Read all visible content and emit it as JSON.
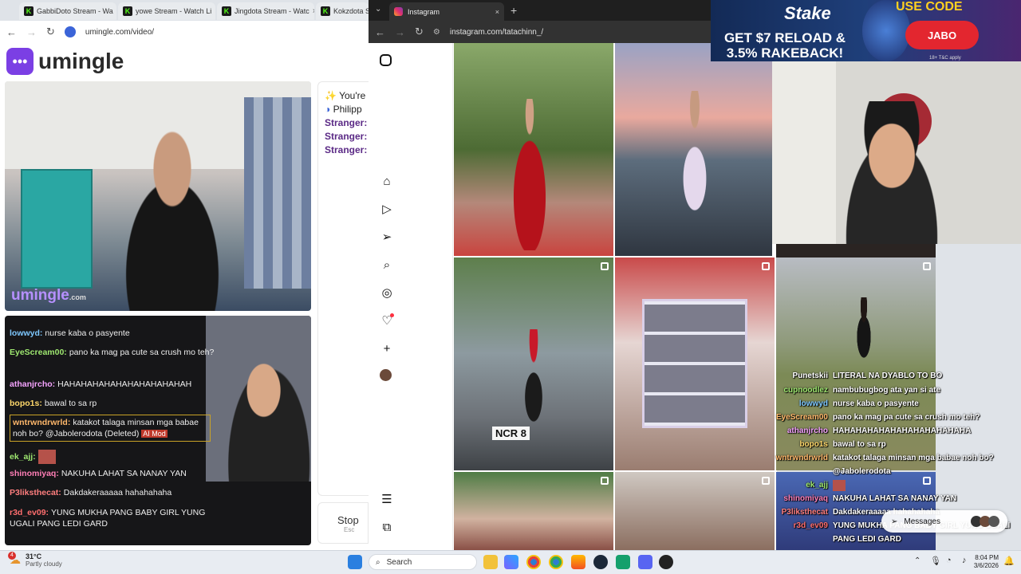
{
  "left_browser": {
    "tabs": [
      "GabbiDoto Stream - Wa",
      "yowe Stream - Watch Li",
      "Jingdota Stream - Watc",
      "Kokzdota Stre"
    ],
    "kick_glyph": "K",
    "url": "umingle.com/video/",
    "logo_text": "umingle",
    "watermark": "umingle",
    "watermark_suffix": ".com",
    "stranger_panel": {
      "line1": "You're",
      "line2": "Philipp",
      "strangers": [
        "Stranger:",
        "Stranger:",
        "Stranger:"
      ]
    },
    "stop": {
      "label": "Stop",
      "hint": "Esc"
    },
    "chat": [
      {
        "user": "lowwyd:",
        "text": "nurse kaba o pasyente",
        "color": "#7ec8ff"
      },
      {
        "user": "EyeScream00:",
        "text": "pano ka mag pa cute sa crush mo teh?",
        "color": "#9fe870"
      },
      {
        "user": "athanjrcho:",
        "text": "HAHAHAHAHAHAHAHAHAHAHAH",
        "color": "#f5a3ff"
      },
      {
        "user": "bopo1s:",
        "text": "bawal to sa rp",
        "color": "#ffd86b"
      },
      {
        "user": "wntrwndrwrld:",
        "text": "katakot talaga minsan mga babae noh bo? @Jabolerodota (Deleted)",
        "color": "#ffb86b"
      },
      {
        "user": "ek_ajj:",
        "text": "",
        "color": "#9fe870"
      },
      {
        "user": "shinomiyaq:",
        "text": "NAKUHA LAHAT SA NANAY YAN",
        "color": "#ff7eb6"
      },
      {
        "user": "P3liksthecat:",
        "text": "Dakdakeraaaaa hahahahaha",
        "color": "#ff7e7e"
      },
      {
        "user": "r3d_ev09:",
        "text": "YUNG MUKHA PANG BABY GIRL YUNG UGALI PANG LEDI GARD",
        "color": "#ff6e6e"
      }
    ],
    "ai_mod": "AI Mod"
  },
  "instagram": {
    "tab_title": "Instagram",
    "url": "instagram.com/tatachinn_/",
    "plate": "NCR 8"
  },
  "ad": {
    "brand": "Stake",
    "offer_line1": "GET $7 RELOAD &",
    "offer_line2": "3.5% RAKEBACK!",
    "use_code": "USE CODE",
    "code": "JABO",
    "terms": "18+ T&C apply"
  },
  "overlay_chat": [
    {
      "user": "Punetskii",
      "text": "LITERAL NA DYABLO TO BO"
    },
    {
      "user": "cupnoodlez",
      "text": "nambubugbog ata yan si ate"
    },
    {
      "user": "lowwyd",
      "text": "nurse kaba o pasyente"
    },
    {
      "user": "EyeScream00",
      "text": "pano ka mag pa cute sa crush mo teh?"
    },
    {
      "user": "athanjrcho",
      "text": "HAHAHAHAHAHAHAHAHAHAHAHA"
    },
    {
      "user": "bopo1s",
      "text": "bawal to sa rp"
    },
    {
      "user": "wntrwndrwrld",
      "text": "katakot talaga minsan mga babae noh bo?"
    },
    {
      "user": "",
      "text": "@Jabolerodota"
    },
    {
      "user": "ek_ajj",
      "text": ""
    },
    {
      "user": "shinomiyaq",
      "text": "NAKUHA LAHAT SA NANAY YAN"
    },
    {
      "user": "P3liksthecat",
      "text": "Dakdakeraaaaa hahahahaha"
    },
    {
      "user": "r3d_ev09",
      "text": "YUNG MUKHA PANG BABY GIRL YUNG UGALI"
    },
    {
      "user": "",
      "text": "PANG LEDI GARD"
    }
  ],
  "messages_label": "Messages",
  "taskbar": {
    "weather_temp": "31°C",
    "weather_desc": "Partly cloudy",
    "alert_badge": "4",
    "search_placeholder": "Search",
    "time": "8:04 PM",
    "date": "3/6/2026"
  }
}
